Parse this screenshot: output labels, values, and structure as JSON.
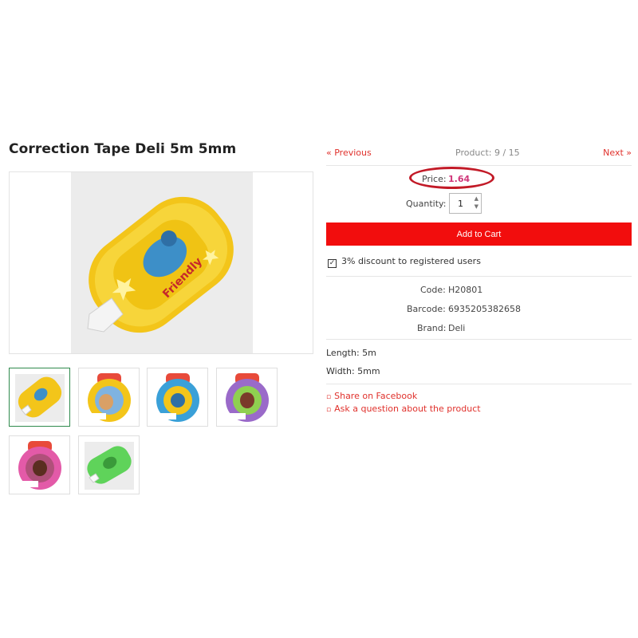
{
  "product": {
    "title": "Correction Tape Deli 5m 5mm"
  },
  "nav": {
    "prev": "« Previous",
    "counter": "Product: 9 / 15",
    "next": "Next »"
  },
  "price": {
    "label": "Price:",
    "value": "1.64"
  },
  "quantity": {
    "label": "Quantity:",
    "value": "1"
  },
  "cart": {
    "label": "Add to Cart"
  },
  "discount": {
    "checked": true,
    "text": "3% discount to registered users"
  },
  "specs": {
    "code_label": "Code:",
    "code_value": "H20801",
    "barcode_label": "Barcode:",
    "barcode_value": "6935205382658",
    "brand_label": "Brand:",
    "brand_value": "Deli"
  },
  "attributes": {
    "length": "Length: 5m",
    "width": "Width: 5mm"
  },
  "share": {
    "facebook": "Share on Facebook",
    "question": "Ask a question about the product"
  },
  "thumbnails": [
    {
      "color": "yellow",
      "active": true
    },
    {
      "color": "yellow-pack"
    },
    {
      "color": "blue-pack"
    },
    {
      "color": "purple-pack"
    },
    {
      "color": "pink-pack"
    },
    {
      "color": "green"
    }
  ],
  "colors": {
    "accent": "#f20d0d",
    "link": "#e0312c",
    "price": "#d0367a",
    "annotation": "#c21a27",
    "active_thumb": "#2f8a4d"
  }
}
